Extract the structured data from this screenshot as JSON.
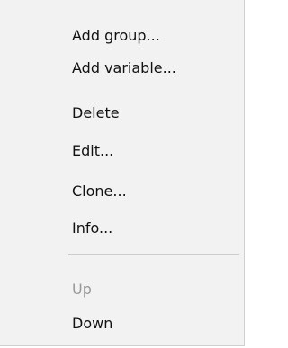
{
  "context_menu": {
    "items": [
      {
        "label": "Add group...",
        "enabled": true
      },
      {
        "label": "Add variable...",
        "enabled": true
      },
      {
        "label": "Delete",
        "enabled": true
      },
      {
        "label": "Edit...",
        "enabled": true
      },
      {
        "label": "Clone...",
        "enabled": true
      },
      {
        "label": "Info...",
        "enabled": true
      },
      {
        "label": "Up",
        "enabled": false
      },
      {
        "label": "Down",
        "enabled": true
      }
    ]
  }
}
